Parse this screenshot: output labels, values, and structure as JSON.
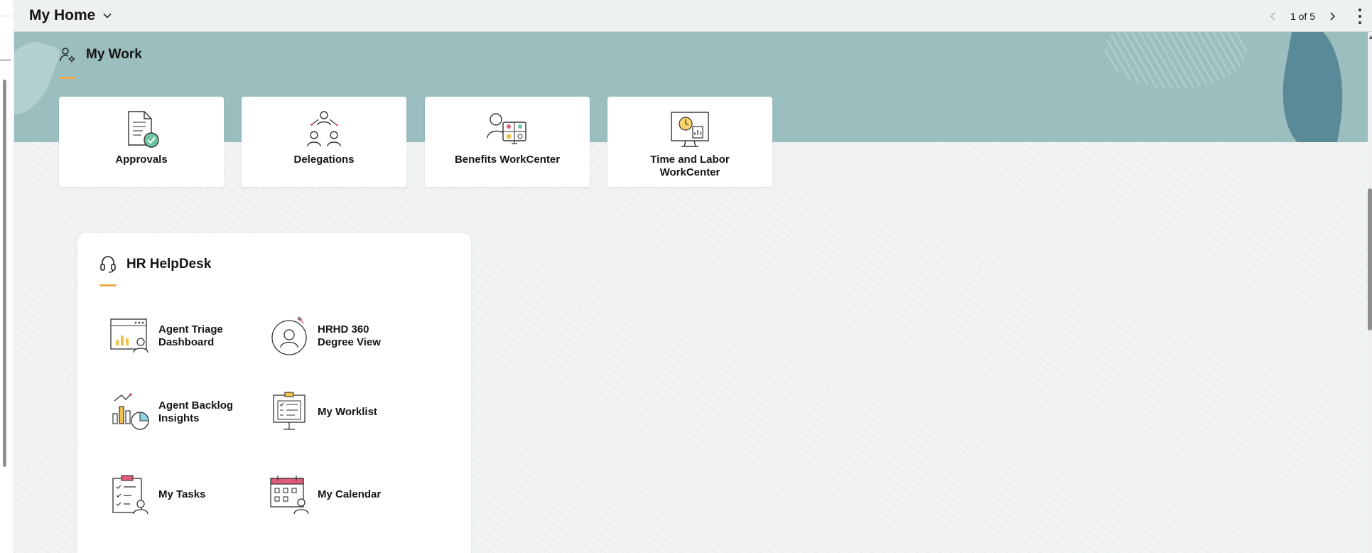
{
  "header": {
    "title": "My Home",
    "pager_text": "1 of 5"
  },
  "my_work": {
    "heading": "My Work",
    "tiles": [
      {
        "label": "Approvals",
        "icon": "document-check-icon"
      },
      {
        "label": "Delegations",
        "icon": "delegation-people-icon"
      },
      {
        "label": "Benefits WorkCenter",
        "icon": "benefits-workcenter-icon"
      },
      {
        "label": "Time and Labor WorkCenter",
        "icon": "time-labor-monitor-icon"
      }
    ]
  },
  "hr_helpdesk": {
    "heading": "HR HelpDesk",
    "items": [
      {
        "label": "Agent Triage Dashboard",
        "icon": "dashboard-person-icon"
      },
      {
        "label": "HRHD 360 Degree View",
        "icon": "person-circle-icon"
      },
      {
        "label": "Agent Backlog Insights",
        "icon": "chart-insights-icon"
      },
      {
        "label": "My Worklist",
        "icon": "worklist-clipboard-icon"
      },
      {
        "label": "My Tasks",
        "icon": "tasks-clipboard-icon"
      },
      {
        "label": "My Calendar",
        "icon": "calendar-person-icon"
      }
    ]
  },
  "colors": {
    "banner": "#9bbfbf",
    "accent_underline": "#e8a84a",
    "check_green": "#4caf7d",
    "alert_pink": "#e05a7a"
  }
}
